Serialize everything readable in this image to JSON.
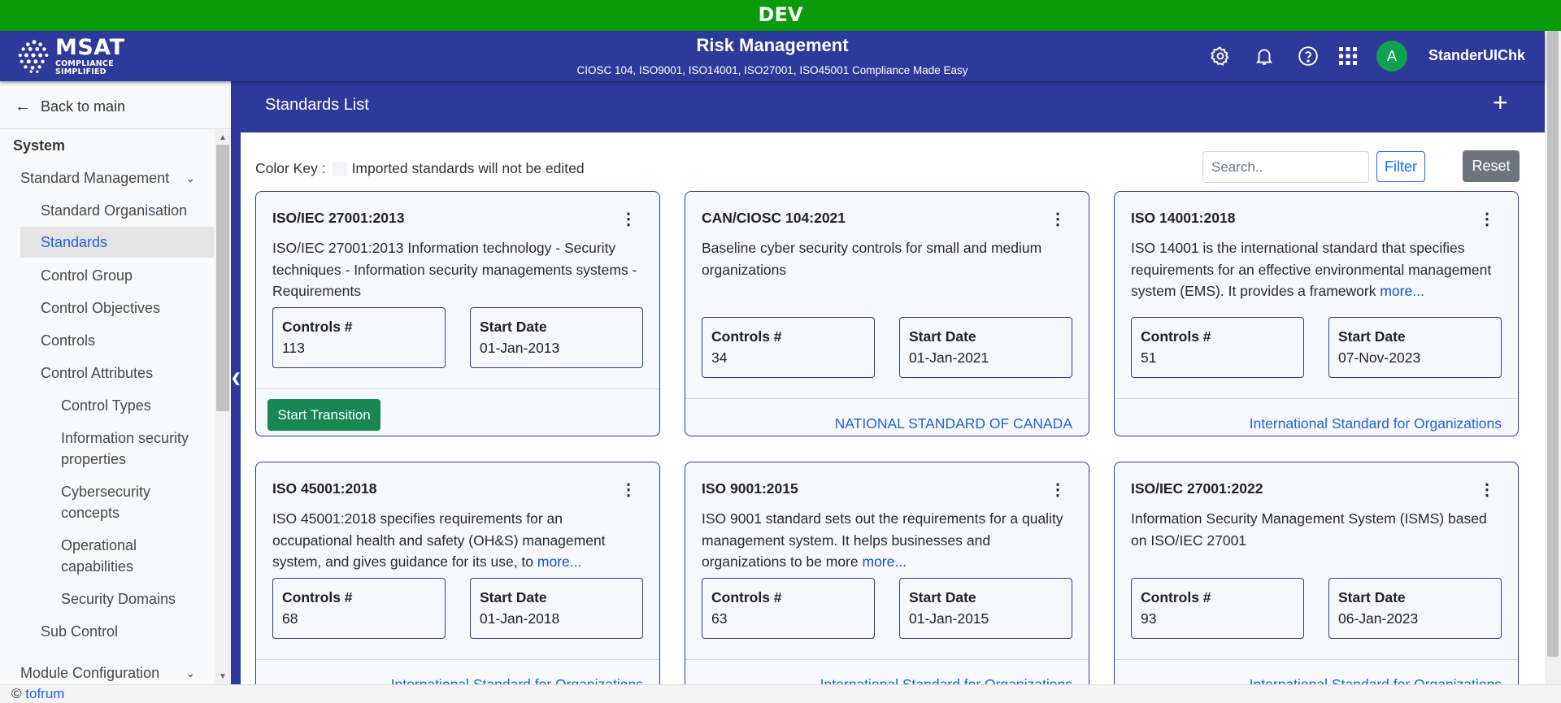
{
  "env": {
    "label": "DEV"
  },
  "header": {
    "logo_main": "MSAT",
    "logo_sub": "COMPLIANCE SIMPLIFIED",
    "title": "Risk Management",
    "subtitle": "CIOSC 104, ISO9001, ISO14001, ISO27001, ISO45001 Compliance Made Easy",
    "icons": [
      "gear-icon",
      "bell-icon",
      "help-icon",
      "apps-grid-icon"
    ],
    "avatar_letter": "A",
    "username": "StanderUIChk",
    "colors": {
      "bar": "#2d3a9b",
      "env": "#0a9a0a",
      "avatar": "#12a150"
    }
  },
  "sidebar": {
    "back_label": "Back to main",
    "section": "System",
    "items": [
      {
        "label": "Standard Management",
        "expandable": true
      },
      {
        "label": "Standard Organisation"
      },
      {
        "label": "Standards",
        "active": true
      },
      {
        "label": "Control Group"
      },
      {
        "label": "Control Objectives"
      },
      {
        "label": "Controls"
      },
      {
        "label": "Control Attributes"
      },
      {
        "label": "Control Types"
      },
      {
        "label": "Information security properties"
      },
      {
        "label": "Cybersecurity concepts"
      },
      {
        "label": "Operational capabilities"
      },
      {
        "label": "Security Domains"
      },
      {
        "label": "Sub Control"
      },
      {
        "label": "Module Configuration",
        "expandable": true
      }
    ]
  },
  "page": {
    "title": "Standards List",
    "add_label": "+",
    "color_key_label": "Color Key :",
    "color_key_text": "Imported standards will not be edited",
    "search_placeholder": "Search..",
    "filter_label": "Filter",
    "reset_label": "Reset"
  },
  "standards": [
    {
      "title": "ISO/IEC 27001:2013",
      "desc_lines": [
        "ISO/IEC 27001:2013 Information technology - Security",
        "techniques - Information security managements systems -",
        "Requirements"
      ],
      "more": "",
      "controls_label": "Controls #",
      "controls": "113",
      "start_label": "Start Date",
      "start_date": "01-Jan-2013",
      "action": "Start Transition",
      "footer_link": ""
    },
    {
      "title": "CAN/CIOSC 104:2021",
      "desc_lines": [
        "Baseline cyber security controls for small and medium",
        "organizations"
      ],
      "more": "",
      "controls_label": "Controls #",
      "controls": "34",
      "start_label": "Start Date",
      "start_date": "01-Jan-2021",
      "action": "",
      "footer_link": "NATIONAL STANDARD OF CANADA"
    },
    {
      "title": "ISO 14001:2018",
      "desc_lines": [
        "ISO 14001 is the international standard that specifies",
        "requirements for an effective environmental management",
        "system (EMS). It provides a framework"
      ],
      "more": "more...",
      "controls_label": "Controls #",
      "controls": "51",
      "start_label": "Start Date",
      "start_date": "07-Nov-2023",
      "action": "",
      "footer_link": "International Standard for Organizations"
    },
    {
      "title": "ISO 45001:2018",
      "desc_lines": [
        "ISO 45001:2018 specifies requirements for an",
        "occupational health and safety (OH&S) management",
        "system, and gives guidance for its use, to"
      ],
      "more": "more...",
      "controls_label": "Controls #",
      "controls": "68",
      "start_label": "Start Date",
      "start_date": "01-Jan-2018",
      "action": "",
      "footer_link": "International Standard for Organizations"
    },
    {
      "title": "ISO 9001:2015",
      "desc_lines": [
        "ISO 9001 standard sets out the requirements for a quality",
        "management system. It helps businesses and",
        "organizations to be more"
      ],
      "more": "more...",
      "controls_label": "Controls #",
      "controls": "63",
      "start_label": "Start Date",
      "start_date": "01-Jan-2015",
      "action": "",
      "footer_link": "International Standard for Organizations"
    },
    {
      "title": "ISO/IEC 27001:2022",
      "desc_lines": [
        "Information Security Management System (ISMS) based",
        "on ISO/IEC 27001"
      ],
      "more": "",
      "controls_label": "Controls #",
      "controls": "93",
      "start_label": "Start Date",
      "start_date": "06-Jan-2023",
      "action": "",
      "footer_link": "International Standard for Organizations"
    }
  ],
  "footer": {
    "copyright": "©",
    "link": "tofrum"
  }
}
